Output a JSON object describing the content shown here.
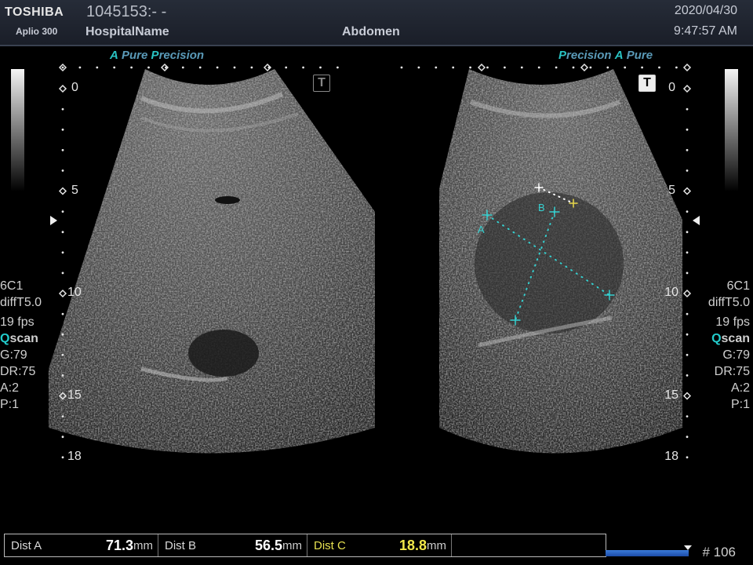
{
  "header": {
    "brand": "TOSHIBA",
    "model": "Aplio 300",
    "patient_id": "1045153:- -",
    "hospital": "HospitalName",
    "exam": "Abdomen",
    "date": "2020/04/30",
    "time": "9:47:57 AM"
  },
  "left_image": {
    "label_a": "A",
    "label_pure": "Pure",
    "label_p": "P",
    "label_precision": "recision",
    "depth_labels": [
      "0",
      "5",
      "10",
      "15",
      "18"
    ],
    "ttl_icon": "T"
  },
  "right_image": {
    "label_p": "P",
    "label_precision": "recision",
    "label_a": "A",
    "label_pure": "Pure",
    "depth_labels": [
      "0",
      "5",
      "10",
      "15",
      "18"
    ],
    "ttl_icon": "T",
    "caliper_labels": [
      "A",
      "B"
    ]
  },
  "left_params": {
    "probe": "6C1",
    "mode": "diffT5.0",
    "fps": "19 fps",
    "q": "Q",
    "scan": "scan",
    "gain": "G:79",
    "dr": "DR:75",
    "a": "A:2",
    "p": "P:1"
  },
  "right_params": {
    "probe": "6C1",
    "mode": "diffT5.0",
    "fps": "19 fps",
    "q": "Q",
    "scan": "scan",
    "gain": "G:79",
    "dr": "DR:75",
    "a": "A:2",
    "p": "P:1"
  },
  "measurements": [
    {
      "label": "Dist A",
      "value": "71.3",
      "unit": "mm"
    },
    {
      "label": "Dist B",
      "value": "56.5",
      "unit": "mm"
    },
    {
      "label": "Dist C",
      "value": "18.8",
      "unit": "mm"
    }
  ],
  "footer": {
    "frame": "# 106",
    "cine_position": 1.0
  },
  "colors": {
    "caliper": "#35d0d0",
    "active_caliper": "#e8d84a",
    "accent": "#29c3c3"
  }
}
